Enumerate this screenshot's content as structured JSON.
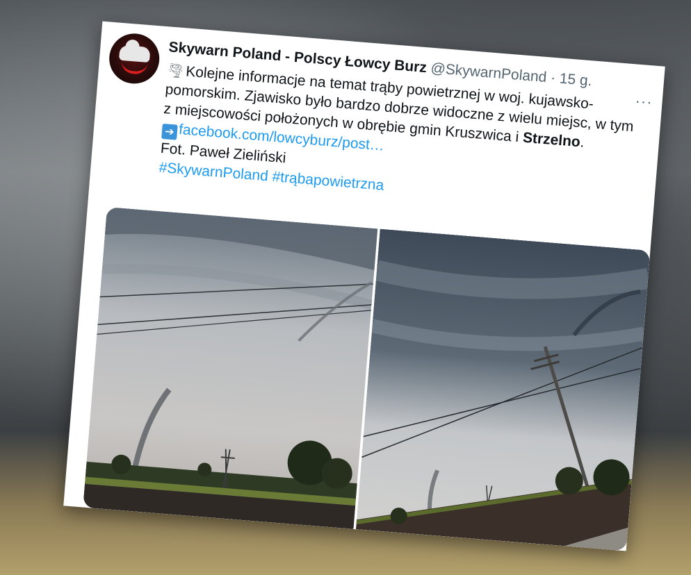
{
  "tweet": {
    "author_name": "Skywarn Poland - Polscy Łowcy Burz",
    "handle": "@SkywarnPoland",
    "separator": "·",
    "time": "15 g.",
    "more_label": "···",
    "emoji_icon": "tornado-icon",
    "text_main": "Kolejne informacje na temat trąby powietrznej w woj. kujawsko-pomorskim. Zjawisko było bardzo dobrze widoczne z wielu miejsc, w tym z miejscowości położonych w obrębie gmin Kruszwica i",
    "text_bold": "Strzelno",
    "text_end": ".",
    "arrow_icon": "arrow-right-icon",
    "link": "facebook.com/lowcyburz/post…",
    "credit": "Fot. Paweł Zieliński",
    "hashtag_1": "#SkywarnPoland",
    "hashtag_2": "#trąbapowietrzna",
    "link_color": "#1d9bf0"
  }
}
